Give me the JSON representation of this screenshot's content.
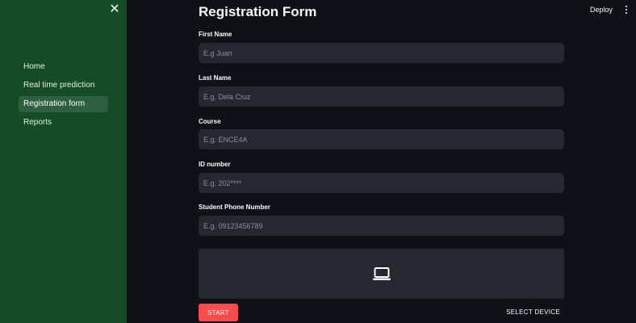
{
  "sidebar": {
    "close_icon": "close-icon",
    "items": [
      {
        "label": "Home",
        "active": false
      },
      {
        "label": "Real time prediction",
        "active": false
      },
      {
        "label": "Registration form",
        "active": true
      },
      {
        "label": "Reports",
        "active": false
      }
    ]
  },
  "topbar": {
    "deploy_label": "Deploy",
    "menu_icon": "kebab-menu-icon"
  },
  "form": {
    "title": "Registration Form",
    "fields": [
      {
        "label": "First Name",
        "placeholder": "E.g Juan",
        "value": ""
      },
      {
        "label": "Last Name",
        "placeholder": "E.g. Dela Cruz",
        "value": ""
      },
      {
        "label": "Course",
        "placeholder": "E.g. ENCE4A",
        "value": ""
      },
      {
        "label": "ID number",
        "placeholder": "E.g. 202****",
        "value": ""
      },
      {
        "label": "Student Phone Number",
        "placeholder": "E.g. 09123456789",
        "value": ""
      }
    ],
    "camera_icon": "laptop-icon",
    "start_label": "START",
    "select_device_label": "SELECT DEVICE"
  },
  "colors": {
    "sidebar_bg": "#144d25",
    "sidebar_active": "#2c6040",
    "main_bg": "#0f1117",
    "input_bg": "#262730",
    "start_button": "#ff4b4b"
  }
}
